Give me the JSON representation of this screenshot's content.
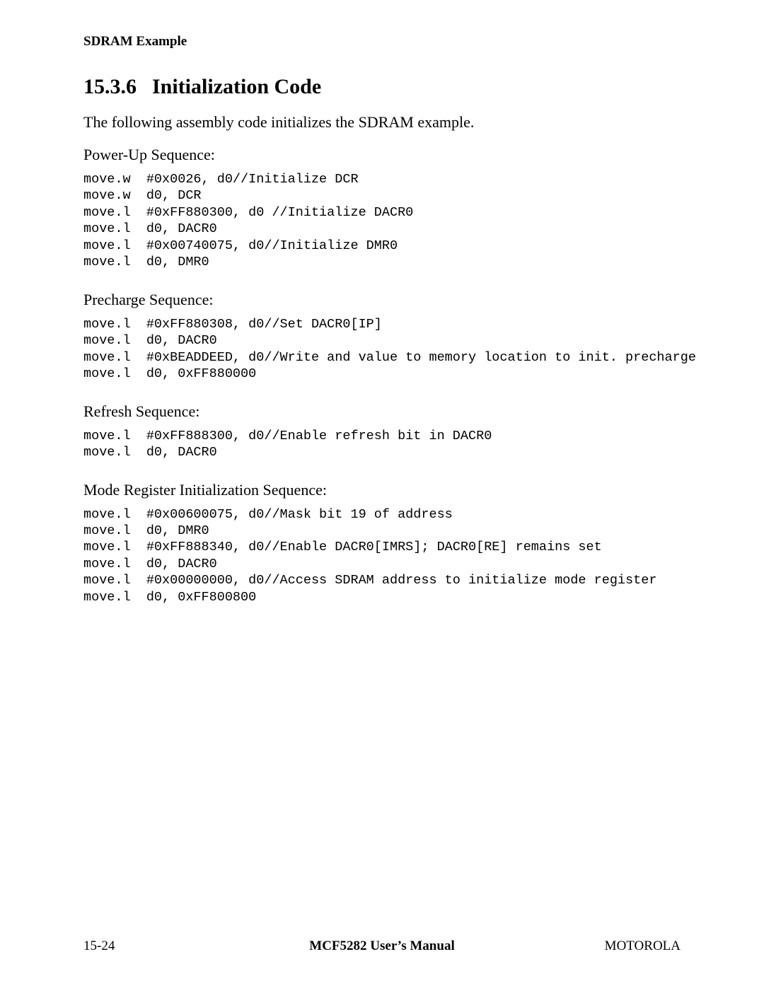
{
  "runningHead": "SDRAM Example",
  "section": {
    "number": "15.3.6",
    "title": "Initialization Code"
  },
  "intro": "The following assembly code initializes the SDRAM example.",
  "blocks": [
    {
      "heading": "Power-Up Sequence:",
      "code": "move.w  #0x0026, d0//Initialize DCR\nmove.w  d0, DCR\nmove.l  #0xFF880300, d0 //Initialize DACR0\nmove.l  d0, DACR0\nmove.l  #0x00740075, d0//Initialize DMR0\nmove.l  d0, DMR0"
    },
    {
      "heading": "Precharge Sequence:",
      "code": "move.l  #0xFF880308, d0//Set DACR0[IP]\nmove.l  d0, DACR0\nmove.l  #0xBEADDEED, d0//Write and value to memory location to init. precharge\nmove.l  d0, 0xFF880000"
    },
    {
      "heading": "Refresh Sequence:",
      "code": "move.l  #0xFF888300, d0//Enable refresh bit in DACR0\nmove.l  d0, DACR0"
    },
    {
      "heading": "Mode Register Initialization Sequence:",
      "code": "move.l  #0x00600075, d0//Mask bit 19 of address\nmove.l  d0, DMR0\nmove.l  #0xFF888340, d0//Enable DACR0[IMRS]; DACR0[RE] remains set\nmove.l  d0, DACR0\nmove.l  #0x00000000, d0//Access SDRAM address to initialize mode register\nmove.l  d0, 0xFF800800"
    }
  ],
  "footer": {
    "left": "15-24",
    "center": "MCF5282 User’s Manual",
    "right": "MOTOROLA"
  }
}
